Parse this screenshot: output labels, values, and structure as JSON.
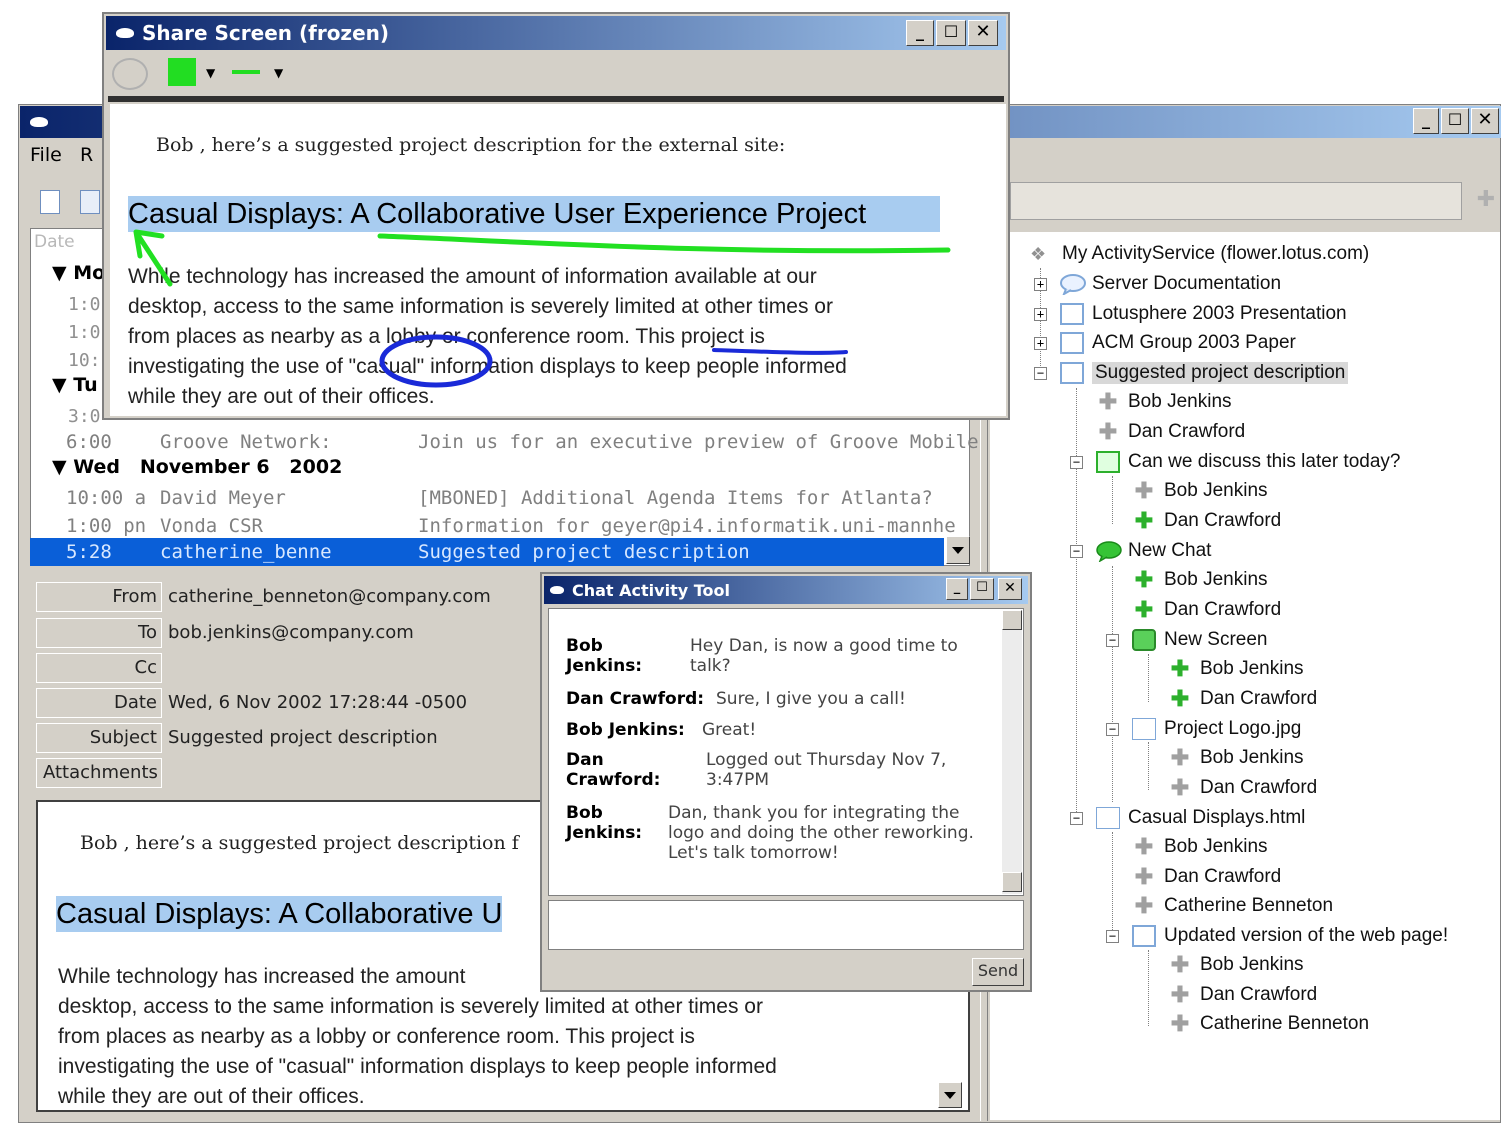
{
  "share_window": {
    "title": "Share Screen (frozen)",
    "intro": "Bob , here’s a suggested project description for the external site:",
    "heading": "Casual Displays: A Collaborative User Experience Project",
    "paragraph_lines": [
      "While technology has increased the amount of information available at our",
      "desktop, access to the same information is severely limited at other times or",
      "from places as nearby as a lobby or conference room. This project is",
      "investigating the use of \"casual\" information displays to keep people informed",
      "while they are out of their offices."
    ]
  },
  "main_window": {
    "menu": {
      "file": "File",
      "r": "R"
    },
    "list_header": "Date",
    "groups": [
      {
        "label": "Mo"
      },
      {
        "label": "Tu"
      },
      {
        "label": "Wed   November 6   2002"
      }
    ],
    "partial_times": [
      "1:0",
      "1:0",
      "10:",
      "3:0"
    ],
    "rows": [
      {
        "time": "6:00",
        "from": "Groove Network:",
        "subject": "Join us for an executive preview of Groove Mobile"
      },
      {
        "time": "10:00 a",
        "from": "David Meyer",
        "subject": "[MBONED] Additional Agenda Items for Atlanta?"
      },
      {
        "time": "1:00 pn",
        "from": "Vonda CSR",
        "subject": "Information for geyer@pi4.informatik.uni-mannhe"
      },
      {
        "time": "5:28",
        "from": "catherine_benne",
        "subject": "Suggested project description"
      }
    ],
    "header_fields": [
      {
        "label": "From",
        "value": "catherine_benneton@company.com"
      },
      {
        "label": "To",
        "value": "bob.jenkins@company.com"
      },
      {
        "label": "Cc",
        "value": ""
      },
      {
        "label": "Date",
        "value": "Wed, 6 Nov 2002 17:28:44 -0500"
      },
      {
        "label": "Subject",
        "value": "Suggested project description"
      },
      {
        "label": "Attachments",
        "value": ""
      }
    ],
    "preview": {
      "intro": "Bob , here’s a suggested project description f",
      "heading": "Casual Displays: A Collaborative U",
      "lines": [
        "While technology has increased the amount",
        "desktop, access to the same information is severely limited at other times or",
        "from places as nearby as a lobby or conference room. This project is",
        "investigating the use of \"casual\" information displays to keep people informed",
        "while they are out of their offices."
      ]
    }
  },
  "chat_window": {
    "title": "Chat Activity Tool",
    "send_label": "Send",
    "messages": [
      {
        "name": "Bob Jenkins:",
        "text": "Hey Dan, is now a good time to talk?"
      },
      {
        "name": "Dan Crawford:",
        "text": "Sure, I give you a call!"
      },
      {
        "name": "Bob Jenkins:",
        "text": "Great!"
      },
      {
        "name": "Dan Crawford:",
        "text": "Logged out Thursday Nov 7, 3:47PM"
      },
      {
        "name": "Bob Jenkins:",
        "text": "Dan, thank you for integrating the logo and doing the other reworking. Let's talk tomorrow!"
      }
    ]
  },
  "activity_tree": {
    "root": "My ActivityService (flower.lotus.com)",
    "items": [
      "Server Documentation",
      "Lotusphere 2003 Presentation",
      "ACM Group 2003 Paper",
      "Suggested project description",
      "Bob Jenkins",
      "Dan Crawford",
      "Can we discuss this later today?",
      "Bob Jenkins",
      "Dan Crawford",
      "New Chat",
      "Bob Jenkins",
      "Dan Crawford",
      "New Screen",
      "Bob Jenkins",
      "Dan Crawford",
      "Project Logo.jpg",
      "Bob Jenkins",
      "Dan Crawford",
      "Casual Displays.html",
      "Bob Jenkins",
      "Dan Crawford",
      "Catherine Benneton",
      "Updated version of the web page!",
      "Bob Jenkins",
      "Dan Crawford",
      "Catherine Benneton"
    ]
  },
  "colors": {
    "selection": "#0a5fd8",
    "highlight": "#a8ccf0",
    "annotation_green": "#22e022",
    "annotation_blue": "#1a2ad8"
  }
}
